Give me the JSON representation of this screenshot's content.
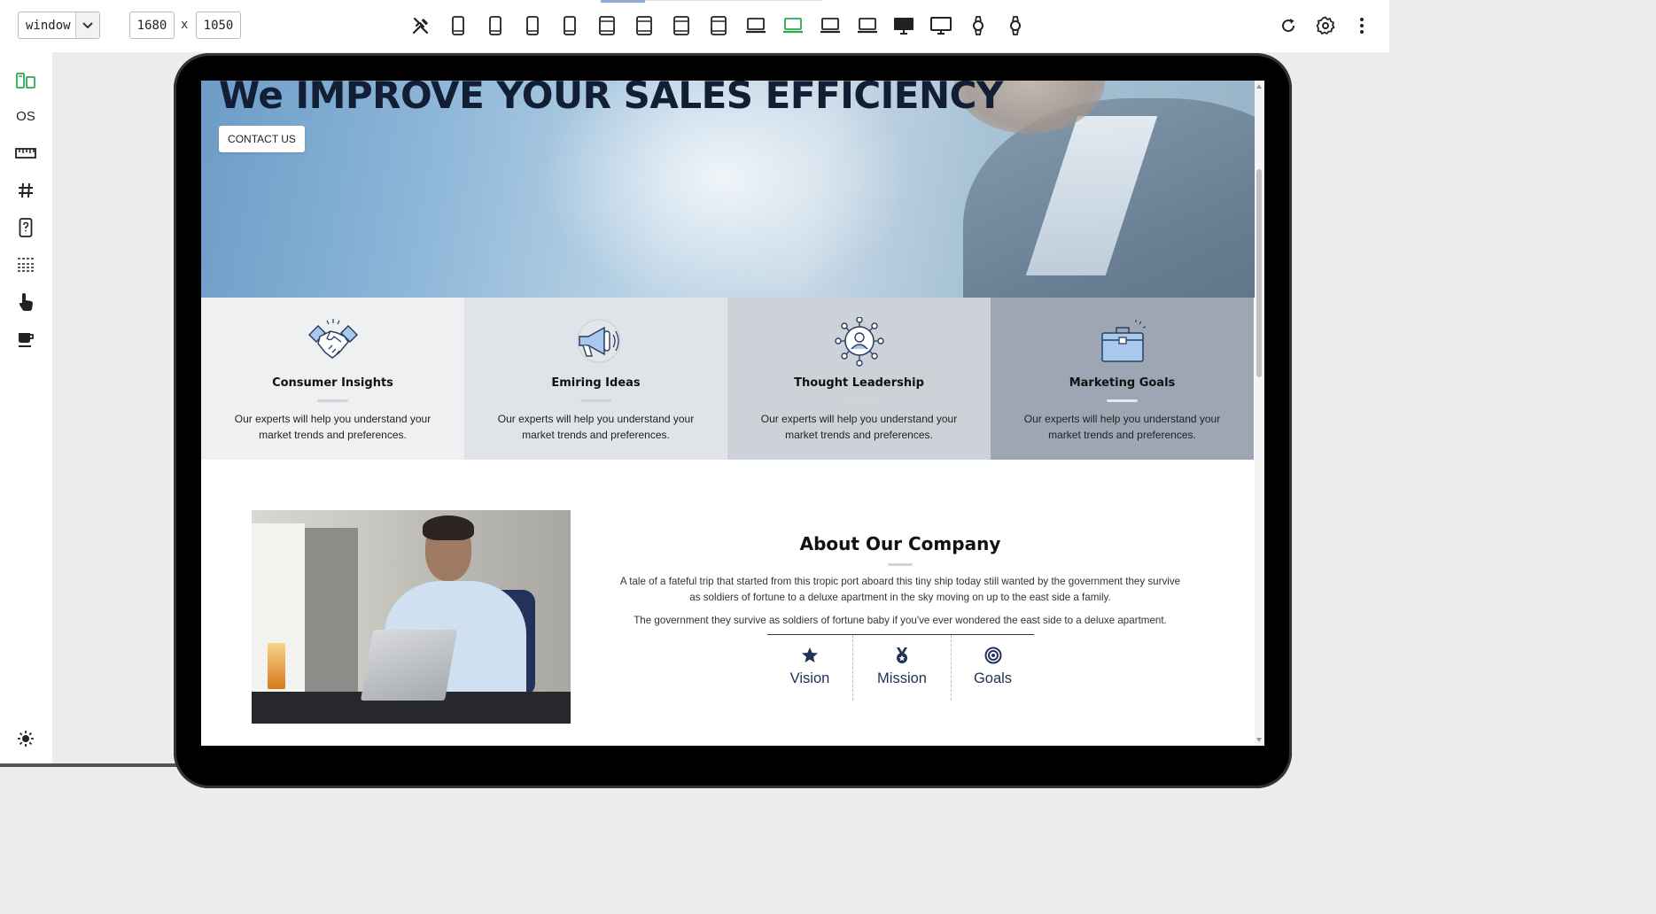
{
  "toolbar": {
    "mode_select": "window",
    "width": "1680",
    "x_label": "x",
    "height": "1050",
    "devices": [
      "tools",
      "phone",
      "phone",
      "phone",
      "phone",
      "tablet",
      "tablet",
      "tablet",
      "tablet",
      "laptop",
      "laptop-active",
      "laptop",
      "laptop",
      "desktop",
      "desktop",
      "watch",
      "watch"
    ]
  },
  "sidebar": {
    "os_label": "OS",
    "items": [
      "responsive-icon",
      "os-label",
      "ruler-icon",
      "grid-icon",
      "device-help-icon",
      "baseline-icon",
      "touch-icon",
      "coffee-icon",
      "theme-toggle-icon"
    ]
  },
  "colors": {
    "accent_green": "#2fa84f",
    "navy": "#23325a",
    "feature_bg": [
      "#eef0f2",
      "#e0e3e7",
      "#cdd1d8",
      "#9ea6b3"
    ]
  },
  "page": {
    "hero": {
      "title": "We IMPROVE YOUR SALES EFFICIENCY",
      "cta": "CONTACT US"
    },
    "features": [
      {
        "icon": "handshake-icon",
        "title": "Consumer Insights",
        "desc": "Our experts will help you understand your market trends and preferences."
      },
      {
        "icon": "megaphone-icon",
        "title": "Emiring Ideas",
        "desc": "Our experts will help you understand your market trends and preferences."
      },
      {
        "icon": "network-person-icon",
        "title": "Thought Leadership",
        "desc": "Our experts will help you understand your market trends and preferences."
      },
      {
        "icon": "briefcase-icon",
        "title": "Marketing Goals",
        "desc": "Our experts will help you understand your market trends and preferences."
      }
    ],
    "about": {
      "title": "About Our Company",
      "p1": "A tale of a fateful trip that started from this tropic port aboard this tiny ship today still wanted by the government they survive as soldiers of fortune to a deluxe apartment in the sky moving on up to the east side a family.",
      "p2": "The government they survive as soldiers of fortune baby if you've ever wondered the east side to a deluxe apartment.",
      "tabs": [
        {
          "icon": "star-icon",
          "label": "Vision"
        },
        {
          "icon": "medal-icon",
          "label": "Mission"
        },
        {
          "icon": "target-icon",
          "label": "Goals"
        }
      ]
    }
  }
}
